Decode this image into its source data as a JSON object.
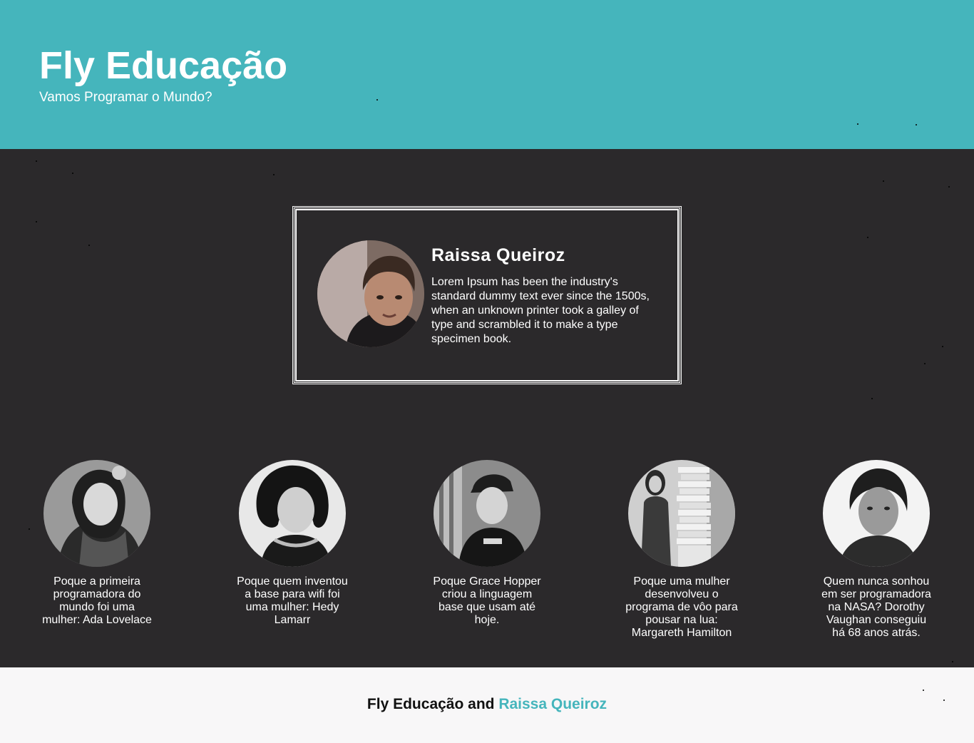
{
  "header": {
    "title": "Fly Educação",
    "subtitle": "Vamos Programar o Mundo?"
  },
  "profile": {
    "avatar_icon": "person-photo-avatar",
    "name": "Raissa Queiroz",
    "bio": "Lorem Ipsum has been the industry's standard dummy text ever since the 1500s, when an unknown printer took a galley of type and scrambled it to make a type specimen book."
  },
  "women": [
    {
      "photo_icon": "portrait-ada-lovelace",
      "caption": "Poque a primeira programadora do mundo foi uma mulher: Ada Lovelace"
    },
    {
      "photo_icon": "portrait-hedy-lamarr",
      "caption": "Poque quem inventou a base para wifi foi uma mulher: Hedy Lamarr"
    },
    {
      "photo_icon": "portrait-grace-hopper",
      "caption": "Poque Grace Hopper criou a linguagem base que usam até hoje."
    },
    {
      "photo_icon": "portrait-margareth-hamilton",
      "caption": "Poque uma mulher desenvolveu o programa de vôo para pousar na lua: Margareth Hamilton"
    },
    {
      "photo_icon": "portrait-dorothy-vaughan",
      "caption": "Quem nunca sonhou em ser programadora na NASA? Dorothy Vaughan conseguiu há 68 anos atrás."
    }
  ],
  "footer": {
    "prefix": "Fly Educação and",
    "link_label": "Raissa Queiroz"
  },
  "colors": {
    "header_bg": "#45b5bc",
    "main_bg": "#2b292b",
    "footer_bg": "#f8f7f8",
    "accent": "#45b5bc"
  }
}
